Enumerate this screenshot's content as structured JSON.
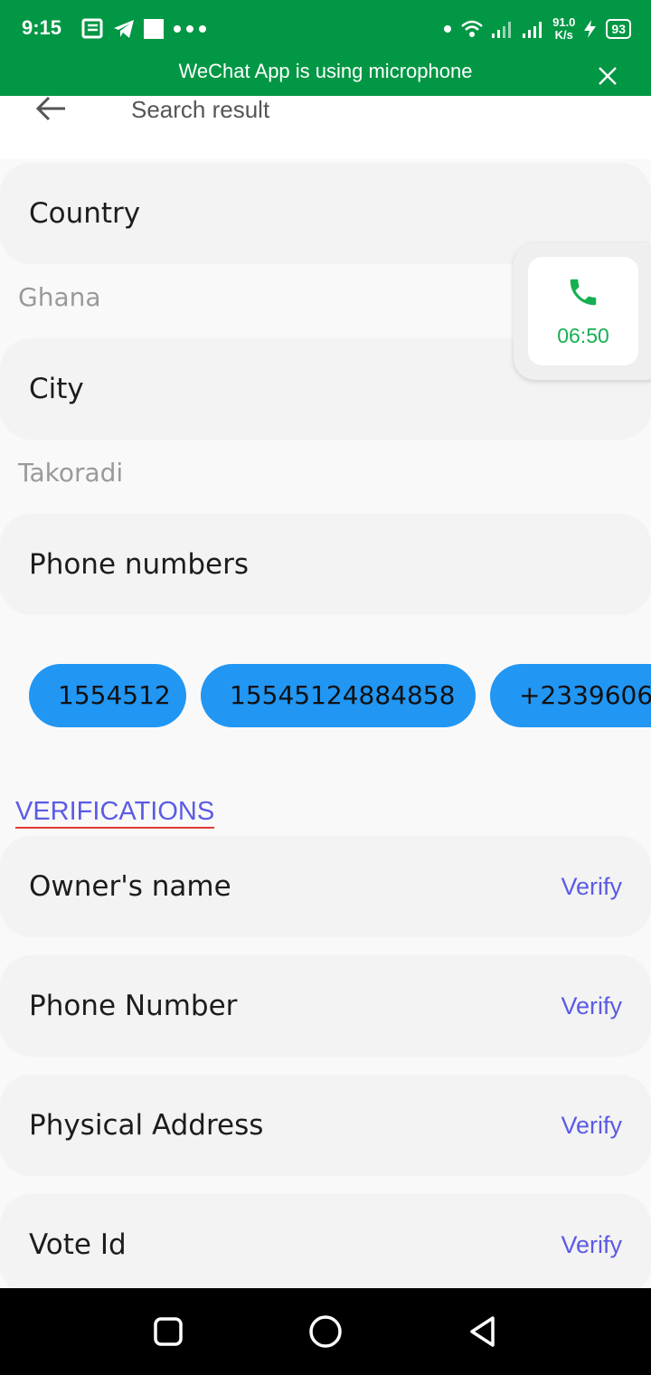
{
  "status_bar": {
    "time": "9:15",
    "net_speed_value": "91.0",
    "net_speed_unit": "K/s",
    "battery": "93",
    "background_color": "#019744"
  },
  "mic_notice": {
    "text": "WeChat App is using microphone"
  },
  "app_bar": {
    "title": "Search result"
  },
  "fields": {
    "country_label": "Country",
    "country_value": "Ghana",
    "city_label": "City",
    "city_value": "Takoradi",
    "phones_label": "Phone numbers"
  },
  "phone_chips": [
    "1554512",
    "15545124884858",
    "+2339606"
  ],
  "verifications": {
    "heading": "VERIFICATIONS",
    "items": [
      {
        "label": "Owner's name",
        "action": "Verify"
      },
      {
        "label": "Phone Number",
        "action": "Verify"
      },
      {
        "label": "Physical Address",
        "action": "Verify"
      },
      {
        "label": "Vote Id",
        "action": "Verify"
      }
    ]
  },
  "call_overlay": {
    "timer": "06:50",
    "icon": "phone-icon",
    "accent": "#16b052"
  },
  "colors": {
    "chip": "#2196f3",
    "link": "#5b5be6",
    "underline": "#e53935"
  }
}
